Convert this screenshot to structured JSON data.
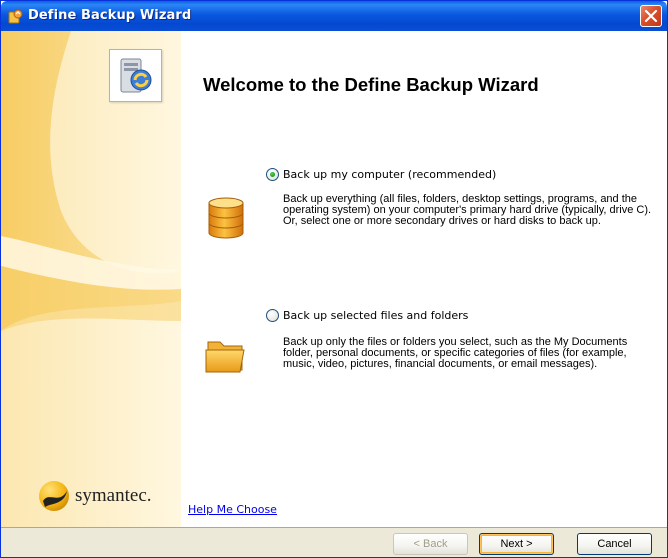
{
  "window": {
    "title": "Define Backup Wizard"
  },
  "main": {
    "heading": "Welcome to the Define Backup Wizard",
    "options": [
      {
        "label": "Back up my computer (recommended)",
        "selected": true,
        "description": "Back up everything (all files, folders, desktop settings, programs, and the operating system) on your computer's primary hard drive (typically, drive C). Or, select one or more secondary drives or hard disks to back up.",
        "icon": "database-icon"
      },
      {
        "label": "Back up selected files and folders",
        "selected": false,
        "description": "Back up only the files or folders you select, such as the My Documents folder, personal documents, or specific categories of files (for example, music, video, pictures, financial documents, or email messages).",
        "icon": "folder-icon"
      }
    ],
    "help_link": "Help Me Choose"
  },
  "sidebar": {
    "brand": "symantec."
  },
  "buttons": {
    "back": "< Back",
    "next": "Next >",
    "cancel": "Cancel"
  },
  "colors": {
    "titlebar": "#0a58e0",
    "panel_accent": "#fce9a8",
    "link": "#0000ee"
  }
}
